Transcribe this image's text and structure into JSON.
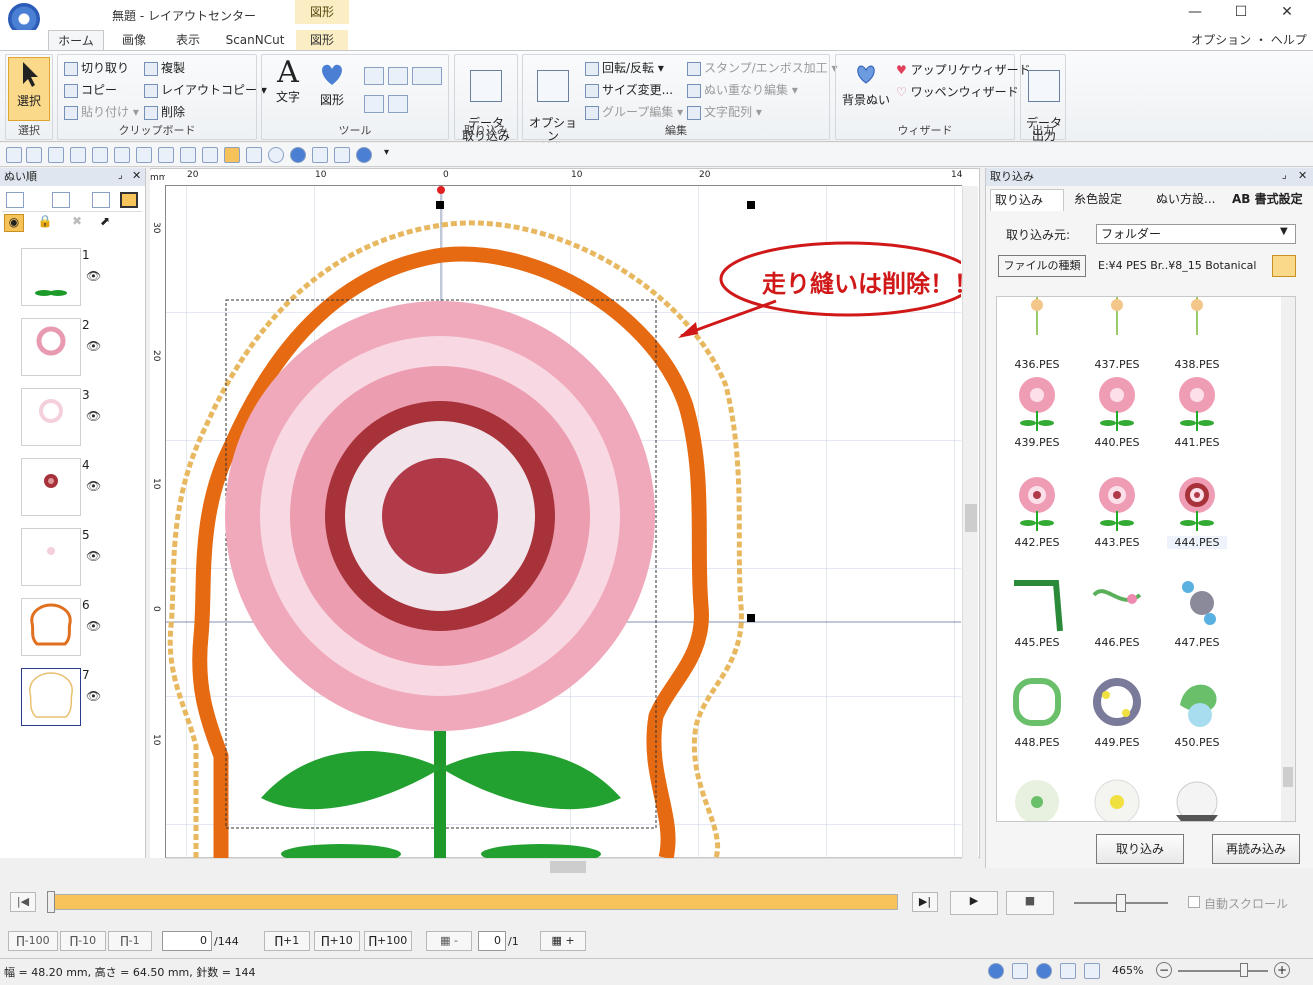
{
  "window": {
    "title": "無題 - レイアウトセンター",
    "context_tab": "図形"
  },
  "ribbon": {
    "tabs": [
      "ホーム",
      "画像",
      "表示",
      "ScanNCut",
      "図形"
    ],
    "options": "オプション ・ ヘルプ ・",
    "select": {
      "label": "選択",
      "group": "選択"
    },
    "clipboard": {
      "cut": "切り取り",
      "copy": "コピー",
      "paste": "貼り付け ▾",
      "duplicate": "複製",
      "layout_copy": "レイアウトコピー ▾",
      "delete": "削除",
      "group": "クリップボード"
    },
    "tools": {
      "text": "文字",
      "shape": "図形",
      "group": "ツール"
    },
    "import": {
      "label": "データ\n取り込み",
      "group": "取り込み"
    },
    "edit": {
      "options": "オプション\n編集",
      "rotate": "回転/反転 ▾",
      "resize": "サイズ変更...",
      "group_edit": "グループ編集 ▾",
      "stamp": "スタンプ/エンボス加工 ▾",
      "overlap": "ぬい重なり編集 ▾",
      "text_arrange": "文字配列 ▾",
      "group": "編集"
    },
    "wizard": {
      "bg": "背景ぬい",
      "applique": "アップリケウィザード",
      "patch": "ワッペンウィザード",
      "group": "ウィザード"
    },
    "output": {
      "label": "データ\n出力",
      "group": "出力"
    }
  },
  "left_panel": {
    "title": "ぬい順",
    "items": [
      "1",
      "2",
      "3",
      "4",
      "5",
      "6",
      "7"
    ]
  },
  "canvas": {
    "annotation": "走り縫いは削除！！",
    "ruler_h": [
      "20",
      "10",
      "0",
      "10",
      "20",
      "14"
    ],
    "ruler_v": [
      "30",
      "20",
      "10",
      "0",
      "10"
    ]
  },
  "right_panel": {
    "title": "取り込み",
    "tabs": [
      "取り込み",
      "糸色設定",
      "ぬい方設...",
      "AB 書式設定"
    ],
    "source_label": "取り込み元:",
    "source_value": "フォルダー",
    "filetype_btn": "ファイルの種類",
    "path": "E:¥4 PES  Br..¥8_15 Botanical",
    "files": [
      "436.PES",
      "437.PES",
      "438.PES",
      "439.PES",
      "440.PES",
      "441.PES",
      "442.PES",
      "443.PES",
      "444.PES",
      "445.PES",
      "446.PES",
      "447.PES",
      "448.PES",
      "449.PES",
      "450.PES"
    ],
    "import_btn": "取り込み",
    "reload_btn": "再読み込み"
  },
  "playback": {
    "auto_scroll": "自動スクロール"
  },
  "steps": {
    "m100": "-100",
    "m10": "-10",
    "m1": "-1",
    "count": "0",
    "total": "/144",
    "p1": "+1",
    "p10": "+10",
    "p100": "+100",
    "color_count": "0",
    "color_total": "/1",
    "minus": "-",
    "plus": "+"
  },
  "status": {
    "info": "幅 = 48.20 mm, 高さ = 64.50 mm, 針数 = 144",
    "zoom": "465%"
  }
}
